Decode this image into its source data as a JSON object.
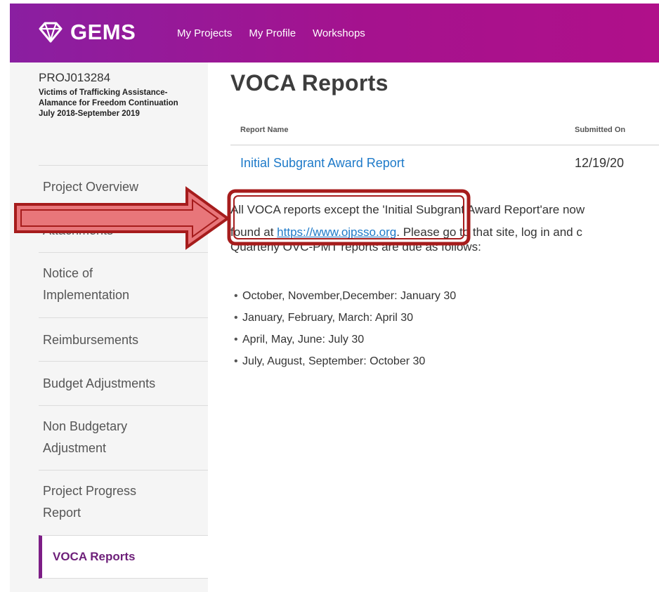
{
  "header": {
    "logo_text": "GEMS",
    "nav": [
      "My Projects",
      "My Profile",
      "Workshops"
    ]
  },
  "sidebar": {
    "project_id": "PROJ013284",
    "project_name": "Victims of Trafficking Assistance-Alamance for Freedom Continuation July 2018-September 2019",
    "items": [
      {
        "label": "Project Overview"
      },
      {
        "label": "Attachments"
      },
      {
        "label": "Notice of Implementation"
      },
      {
        "label": "Reimbursements"
      },
      {
        "label": "Budget Adjustments"
      },
      {
        "label": "Non Budgetary Adjustment"
      },
      {
        "label": "Project Progress Report"
      },
      {
        "label": "VOCA Reports"
      }
    ]
  },
  "main": {
    "title": "VOCA Reports",
    "table": {
      "headers": [
        "Report Name",
        "Submitted On"
      ],
      "rows": [
        {
          "name": "Initial Subgrant Award Report",
          "date": "12/19/20"
        }
      ]
    },
    "notice": {
      "line1": "All VOCA reports except the 'Initial Subgrant Award Report'are now",
      "line2_prefix": "found at ",
      "link": "https://www.ojpsso.org",
      "line2_suffix": ". Please go to that site, log in and c"
    },
    "quarterly_heading": "Quarterly OVC-PMT reports are due as follows:",
    "schedule": [
      "October, November,December: January 30",
      "January, February, March: April 30",
      "April, May, June: July 30",
      "July, August, September: October 30"
    ]
  },
  "colors": {
    "header_gradient_start": "#8a1fa1",
    "header_gradient_end": "#b0108a",
    "active_accent": "#7d1d86",
    "link": "#1e7ac9",
    "annotation_red": "#a61c1c"
  }
}
